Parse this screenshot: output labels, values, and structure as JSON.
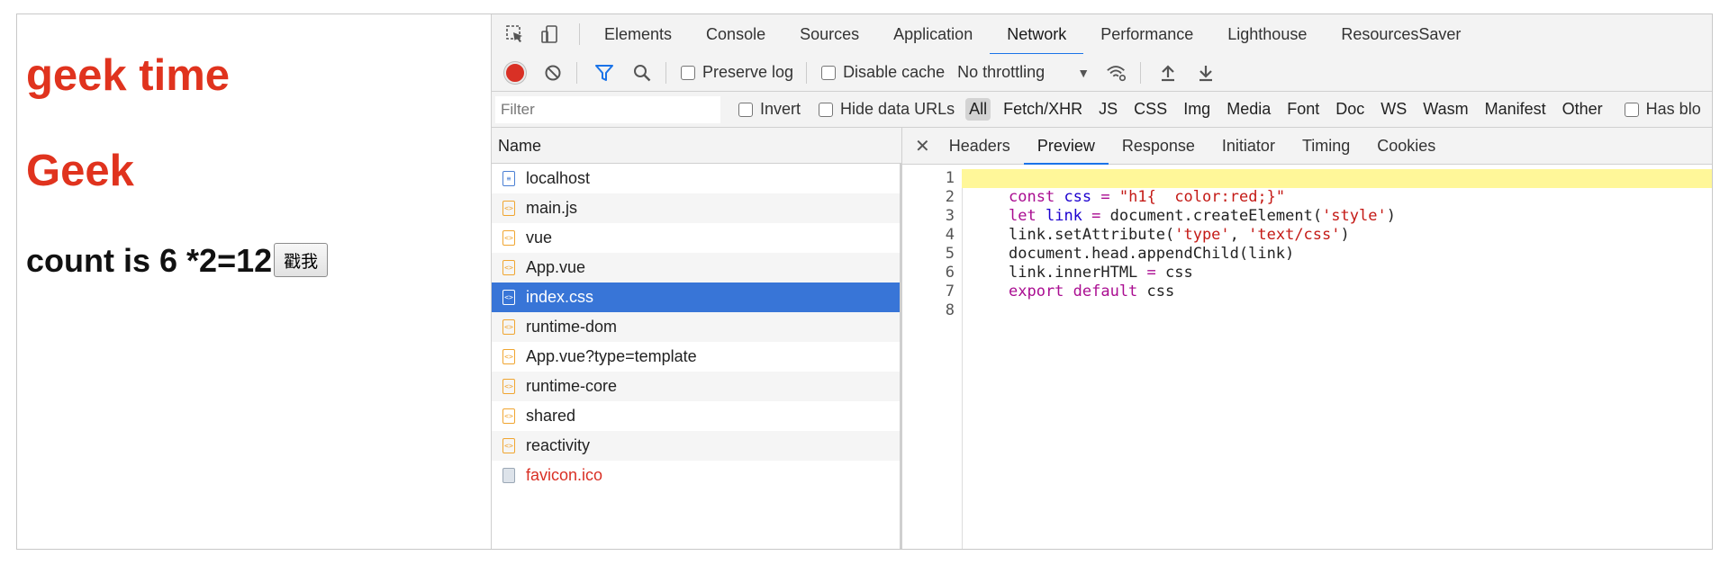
{
  "page": {
    "title": "geek time",
    "subtitle": "Geek",
    "count_text": "count is 6 *2=12",
    "button_label": "戳我"
  },
  "devtools": {
    "tabs": [
      "Elements",
      "Console",
      "Sources",
      "Application",
      "Network",
      "Performance",
      "Lighthouse",
      "ResourcesSaver"
    ],
    "active_tab": "Network",
    "toolbar": {
      "preserve_log": "Preserve log",
      "disable_cache": "Disable cache",
      "throttling": "No throttling"
    },
    "filterbar": {
      "placeholder": "Filter",
      "invert": "Invert",
      "hide_data_urls": "Hide data URLs",
      "types": [
        "All",
        "Fetch/XHR",
        "JS",
        "CSS",
        "Img",
        "Media",
        "Font",
        "Doc",
        "WS",
        "Wasm",
        "Manifest",
        "Other"
      ],
      "has_blocked": "Has blo"
    },
    "list_header": "Name",
    "requests": [
      {
        "name": "localhost",
        "icon": "document-icon"
      },
      {
        "name": "main.js",
        "icon": "script-file-icon"
      },
      {
        "name": "vue",
        "icon": "script-file-icon"
      },
      {
        "name": "App.vue",
        "icon": "script-file-icon"
      },
      {
        "name": "index.css",
        "icon": "script-file-icon",
        "selected": true
      },
      {
        "name": "runtime-dom",
        "icon": "script-file-icon"
      },
      {
        "name": "App.vue?type=template",
        "icon": "script-file-icon"
      },
      {
        "name": "runtime-core",
        "icon": "script-file-icon"
      },
      {
        "name": "shared",
        "icon": "script-file-icon"
      },
      {
        "name": "reactivity",
        "icon": "script-file-icon"
      },
      {
        "name": "favicon.ico",
        "icon": "image-file-icon",
        "error": true
      }
    ],
    "detail_tabs": [
      "Headers",
      "Preview",
      "Response",
      "Initiator",
      "Timing",
      "Cookies"
    ],
    "active_detail_tab": "Preview",
    "code_lines": [
      "",
      "const css = \"h1{  color:red;}\"",
      "let link = document.createElement('style')",
      "link.setAttribute('type', 'text/css')",
      "document.head.appendChild(link)",
      "link.innerHTML = css",
      "export default css",
      ""
    ],
    "line_numbers": [
      "1",
      "2",
      "3",
      "4",
      "5",
      "6",
      "7",
      "8"
    ],
    "colors": {
      "accent": "#1a73e8",
      "selected_row": "#3875d7",
      "record": "#d93025",
      "heading_red": "#e0331e",
      "highlight_line": "#fff799"
    }
  }
}
